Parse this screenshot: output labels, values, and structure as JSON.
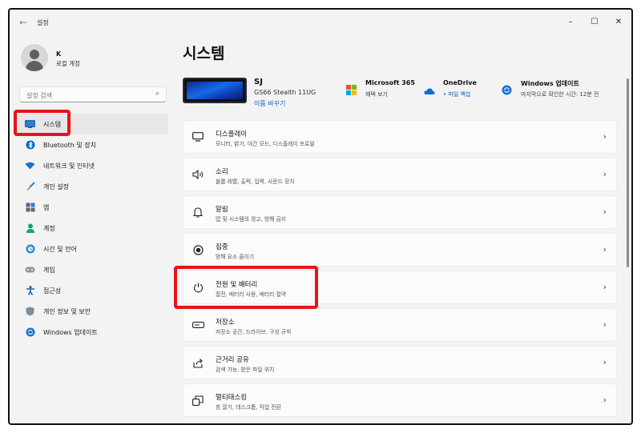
{
  "window": {
    "title": "설정",
    "back_glyph": "←",
    "controls": {
      "minimize": "–",
      "maximize": "☐",
      "close": "✕"
    }
  },
  "profile": {
    "name": "K",
    "account_type": "로컬 계정"
  },
  "search": {
    "placeholder": "설정 검색",
    "icon": "search-icon"
  },
  "sidebar": {
    "items": [
      {
        "label": "시스템",
        "icon": "monitor-icon",
        "selected": true
      },
      {
        "label": "Bluetooth 및 장치",
        "icon": "bluetooth-icon"
      },
      {
        "label": "네트워크 및 인터넷",
        "icon": "wifi-icon"
      },
      {
        "label": "개인 설정",
        "icon": "brush-icon"
      },
      {
        "label": "앱",
        "icon": "apps-icon"
      },
      {
        "label": "계정",
        "icon": "person-icon"
      },
      {
        "label": "시간 및 언어",
        "icon": "globe-clock-icon"
      },
      {
        "label": "게임",
        "icon": "gamepad-icon"
      },
      {
        "label": "접근성",
        "icon": "accessibility-icon"
      },
      {
        "label": "개인 정보 및 보안",
        "icon": "shield-icon"
      },
      {
        "label": "Windows 업데이트",
        "icon": "update-icon"
      }
    ]
  },
  "main": {
    "title": "시스템",
    "device": {
      "name": "SJ",
      "model": "GS66 Stealth 11UG",
      "rename": "이름 바꾸기"
    },
    "info": [
      {
        "title": "Microsoft 365",
        "sub": "혜택 보기",
        "icon": "microsoft-logo-icon"
      },
      {
        "title": "OneDrive",
        "sub": "• 파일 백업",
        "icon": "cloud-icon"
      },
      {
        "title": "Windows 업데이트",
        "sub": "마지막으로 확인한 시간: 12분 전",
        "icon": "update-icon"
      }
    ],
    "cards": [
      {
        "title": "디스플레이",
        "sub": "모니터, 밝기, 야간 모드, 디스플레이 프로필",
        "icon": "display-icon"
      },
      {
        "title": "소리",
        "sub": "볼륨 레벨, 출력, 입력, 사운드 장치",
        "icon": "speaker-icon"
      },
      {
        "title": "알림",
        "sub": "앱 및 시스템의 경고, 방해 금지",
        "icon": "bell-icon"
      },
      {
        "title": "집중",
        "sub": "방해 요소 줄이기",
        "icon": "focus-icon"
      },
      {
        "title": "전원 및 배터리",
        "sub": "절전, 배터리 사용, 배터리 절약",
        "icon": "power-icon"
      },
      {
        "title": "저장소",
        "sub": "저장소 공간, 드라이브, 구성 규칙",
        "icon": "storage-icon"
      },
      {
        "title": "근거리 공유",
        "sub": "검색 가능, 받은 파일 위치",
        "icon": "share-icon"
      },
      {
        "title": "멀티태스킹",
        "sub": "창 끌기, 데스크톱, 작업 전환",
        "icon": "multitask-icon"
      }
    ],
    "chevron": "›"
  },
  "colors": {
    "accent": "#0a67c8",
    "highlight": "#e8141c",
    "background": "#f3f3f3",
    "card": "#fbfbfb"
  }
}
